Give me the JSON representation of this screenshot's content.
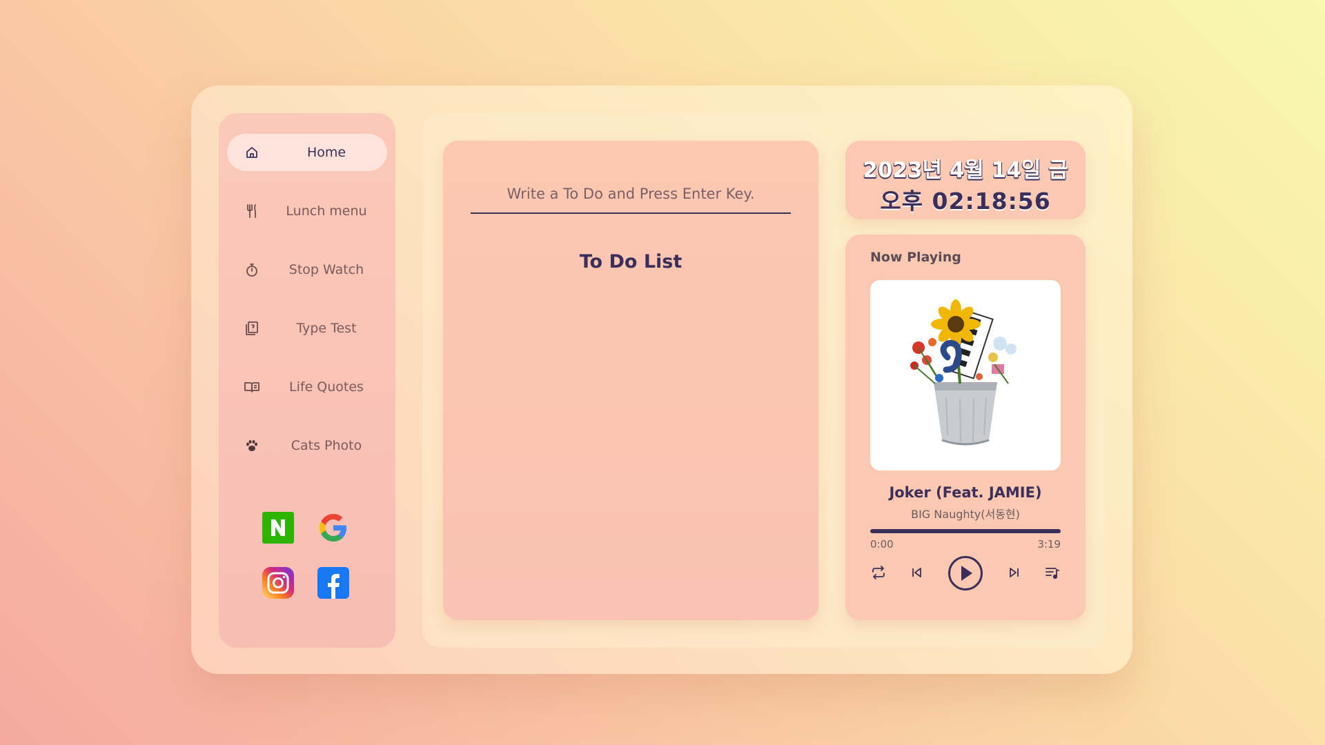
{
  "sidebar": {
    "items": [
      {
        "label": "Home",
        "icon": "home-icon",
        "active": true
      },
      {
        "label": "Lunch menu",
        "icon": "utensils-icon"
      },
      {
        "label": "Stop Watch",
        "icon": "stopwatch-icon"
      },
      {
        "label": "Type Test",
        "icon": "keyboard-question-icon"
      },
      {
        "label": "Life Quotes",
        "icon": "book-icon"
      },
      {
        "label": "Cats Photo",
        "icon": "paw-icon"
      }
    ],
    "social": [
      {
        "name": "Naver",
        "letter": "N",
        "color": "#2db400"
      },
      {
        "name": "Google",
        "letter": "G"
      },
      {
        "name": "Instagram"
      },
      {
        "name": "Facebook",
        "letter": "f",
        "color": "#1877f2"
      }
    ]
  },
  "todo": {
    "placeholder": "Write a To Do and Press Enter Key.",
    "title": "To Do List"
  },
  "clock": {
    "date": "2023년 4월 14일 금",
    "time": "오후 02:18:56"
  },
  "player": {
    "label": "Now Playing",
    "title": "Joker (Feat. JAMIE)",
    "artist": "BIG Naughty(서동현)",
    "current_time": "0:00",
    "total_time": "3:19",
    "progress_fraction": 1.0
  },
  "colors": {
    "accent": "#3b2e5a",
    "card": "#fbc9b1"
  }
}
